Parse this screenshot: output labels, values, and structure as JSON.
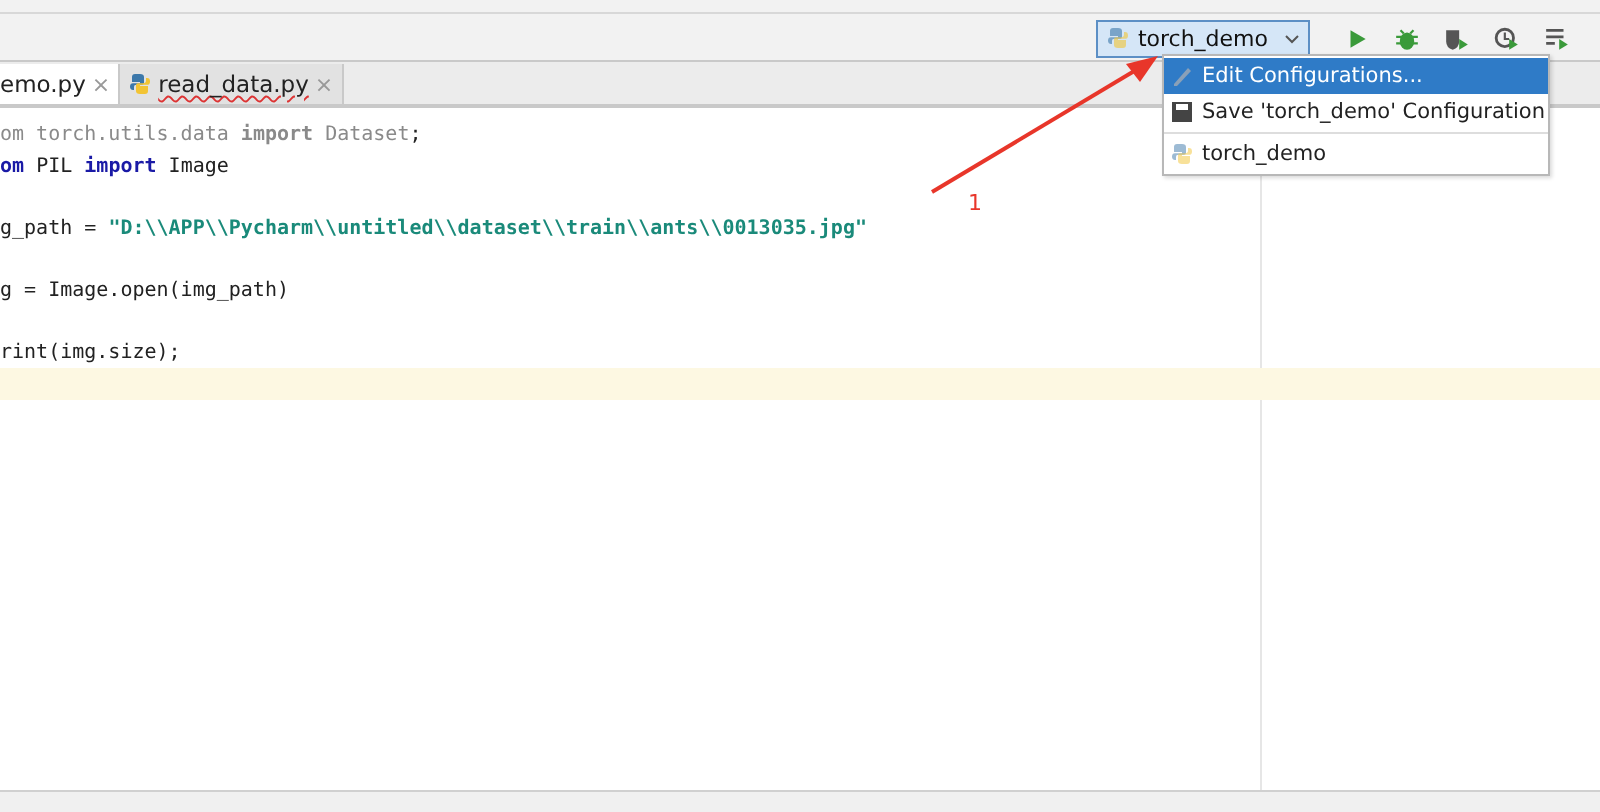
{
  "toolbar": {
    "run_config": {
      "label": "torch_demo",
      "selected": true
    },
    "actions": [
      {
        "kind": "run"
      },
      {
        "kind": "debug"
      },
      {
        "kind": "coverage"
      },
      {
        "kind": "profile"
      },
      {
        "kind": "concurrency"
      }
    ]
  },
  "tabs": [
    {
      "label": "emo.py",
      "selected": true,
      "close": "×"
    },
    {
      "label": "read_data.py",
      "selected": false,
      "close": "×"
    }
  ],
  "editor": {
    "lines": [
      {
        "kind": "code",
        "tokens": [
          {
            "kind": "unused",
            "text": "om torch.utils.data "
          },
          {
            "kind": "unused_keyword",
            "text": "import"
          },
          {
            "kind": "unused",
            "text": " Dataset"
          },
          {
            "kind": "plain",
            "text": ";"
          }
        ]
      },
      {
        "kind": "code",
        "tokens": [
          {
            "kind": "keyword",
            "text": "om"
          },
          {
            "kind": "plain",
            "text": " PIL "
          },
          {
            "kind": "keyword",
            "text": "import"
          },
          {
            "kind": "plain",
            "text": " Image"
          }
        ]
      },
      {
        "kind": "blank"
      },
      {
        "kind": "code",
        "tokens": [
          {
            "kind": "plain",
            "text": "g_path = "
          },
          {
            "kind": "string",
            "text": "\"D:\\\\APP\\\\Pycharm\\\\untitled\\\\dataset\\\\train\\\\ants\\\\0013035.jpg\""
          }
        ]
      },
      {
        "kind": "blank"
      },
      {
        "kind": "code",
        "tokens": [
          {
            "kind": "plain",
            "text": "g = Image.open(img_path)"
          }
        ]
      },
      {
        "kind": "blank"
      },
      {
        "kind": "code",
        "tokens": [
          {
            "kind": "plain",
            "text": "rint(img.size)"
          },
          {
            "kind": "plain",
            "text": ";"
          }
        ]
      },
      {
        "kind": "current_blank"
      }
    ]
  },
  "dropdown": {
    "items": [
      {
        "kind": "edit",
        "label": "Edit Configurations...",
        "selected": true
      },
      {
        "kind": "save",
        "label": "Save 'torch_demo' Configuration",
        "selected": false
      },
      {
        "kind": "config",
        "label": "torch_demo",
        "selected": false
      }
    ]
  },
  "annotation": {
    "label": "1"
  }
}
